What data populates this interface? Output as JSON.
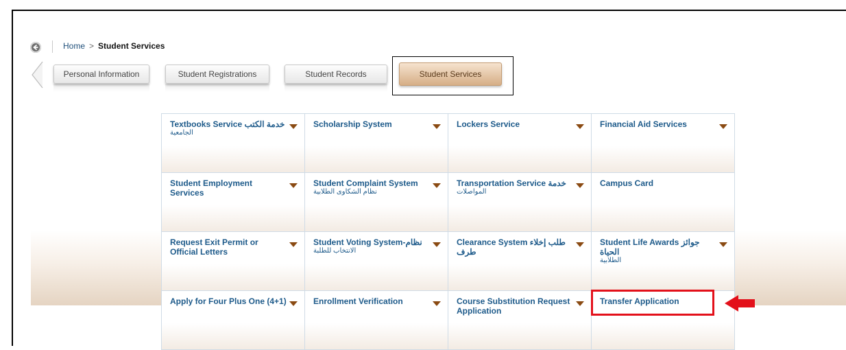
{
  "breadcrumb": {
    "home": "Home",
    "separator": ">",
    "current": "Student Services"
  },
  "tabs": [
    {
      "label": "Personal Information",
      "active": false
    },
    {
      "label": "Student Registrations",
      "active": false
    },
    {
      "label": "Student Records",
      "active": false
    },
    {
      "label": "Student Services",
      "active": true
    }
  ],
  "services": [
    {
      "title": "Textbooks Service خدمة الكتب",
      "sub": "الجامعية",
      "has_menu": true
    },
    {
      "title": "Scholarship System",
      "sub": "",
      "has_menu": true
    },
    {
      "title": "Lockers Service",
      "sub": "",
      "has_menu": true
    },
    {
      "title": "Financial Aid Services",
      "sub": "",
      "has_menu": true
    },
    {
      "title": "Student Employment Services",
      "sub": "",
      "has_menu": true
    },
    {
      "title": "Student Complaint System",
      "sub": "نظام الشكاوى الطلابية",
      "has_menu": true
    },
    {
      "title": "Transportation Service خدمة",
      "sub": "المواصلات",
      "has_menu": true
    },
    {
      "title": "Campus Card",
      "sub": "",
      "has_menu": false
    },
    {
      "title": "Request Exit Permit or Official Letters",
      "sub": "",
      "has_menu": true
    },
    {
      "title": "Student Voting System-نظام",
      "sub": "الانتخاب للطلبة",
      "has_menu": true
    },
    {
      "title": "Clearance System طلب إخلاء طرف",
      "sub": "",
      "has_menu": true
    },
    {
      "title": "Student Life Awards جوائز الحياة",
      "sub": "الطلابية",
      "has_menu": true
    },
    {
      "title": "Apply for Four Plus One (4+1)",
      "sub": "",
      "has_menu": true
    },
    {
      "title": "Enrollment Verification",
      "sub": "",
      "has_menu": true
    },
    {
      "title": "Course Substitution Request Application",
      "sub": "",
      "has_menu": true
    },
    {
      "title": "Transfer Application",
      "sub": "",
      "has_menu": false
    }
  ],
  "colors": {
    "link": "#1d5a8a",
    "highlight": "#e3101a",
    "active_tab": "#d6ae86"
  },
  "icons": {
    "back": "back-arrow-icon",
    "menu": "caret-down-icon",
    "pointer": "red-arrow-icon"
  }
}
